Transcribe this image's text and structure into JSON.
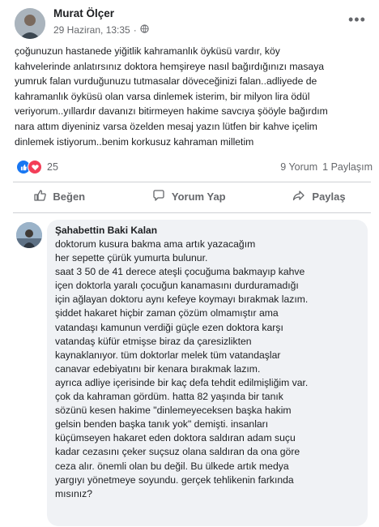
{
  "post": {
    "author": "Murat Ölçer",
    "timestamp": "29 Haziran, 13:35",
    "audience_icon": "globe-icon",
    "more_icon": "more-options-icon",
    "text": "çoğunuzun hastanede yiğitlik kahramanlık öyküsü vardır, köy\nkahvelerinde anlatırsınız doktora hemşireye nasıl bağırdığınızı masaya\nyumruk falan vurduğunuzu tutmasalar döveceğinizi falan..adliyede de\nkahramanlık öyküsü olan varsa dinlemek isterim, bir milyon lira ödül\nveriyorum..yıllardır davanızı bitirmeyen hakime savcıya şööyle bağırdım\nnara attım diyeniniz varsa özelden mesaj yazın lütfen bir kahve içelim\ndinlemek istiyorum..benim korkusuz kahraman milletim"
  },
  "reactions": {
    "count": "25",
    "icons": [
      "like-icon",
      "love-icon"
    ]
  },
  "stats": {
    "comments": "9 Yorum",
    "shares": "1 Paylaşım"
  },
  "actions": {
    "like": "Beğen",
    "comment": "Yorum Yap",
    "share": "Paylaş"
  },
  "comment": {
    "author": "Şahabettin Baki Kalan",
    "text": "doktorum kusura bakma ama artık yazacağım\nher sepette çürük yumurta bulunur.\nsaat 3 50 de 41 derece ateşli çocuğuma bakmayıp kahve\niçen doktorla yaralı çocuğun kanamasını durduramadığı\niçin ağlayan doktoru aynı kefeye koymayı bırakmak lazım.\nşiddet hakaret hiçbir zaman çözüm olmamıştır ama\nvatandaşı kamunun verdiği güçle ezen doktora karşı\nvatandaş küfür etmişse biraz da çaresizlikten\nkaynaklanıyor. tüm doktorlar melek tüm vatandaşlar\ncanavar edebiyatını bir kenara bırakmak lazım.\nayrıca adliye içerisinde bir kaç defa tehdit edilmişliğim var.\nçok da kahraman gördüm. hatta 82 yaşında bir tanık\nsözünü kesen hakime \"dinlemeyeceksen başka hakim\ngelsin benden başka tanık yok\" demişti. insanları\nküçümseyen hakaret eden doktora saldıran adam suçu\nkadar cezasını çeker suçsuz olana saldıran da ona göre\nceza alır. önemli olan bu değil. Bu ülkede artık medya\nyargıyı yönetmeye soyundu. gerçek tehlikenin farkında\nmısınız?"
  },
  "colors": {
    "like_blue": "#1877f2",
    "love_red": "#f33e58",
    "secondary_text": "#65676b",
    "bubble_bg": "#f0f2f5"
  }
}
